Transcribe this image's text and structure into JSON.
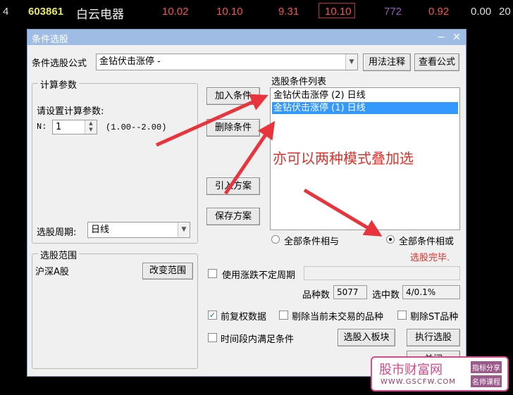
{
  "ticker": {
    "row_num": "4",
    "code": "603861",
    "name": "白云电器",
    "v1": "10.02",
    "v2": "10.10",
    "v3": "9.31",
    "v4": "10.10",
    "v5": "772",
    "v6": "0.92",
    "v7": "0.00",
    "v8": "20"
  },
  "dialog": {
    "title": "条件选股",
    "minimize_glyph": "−",
    "close_glyph": "✕",
    "formula_label": "条件选股公式",
    "formula_value": "金钻伏击涨停 -",
    "btn_usage": "用法注释",
    "btn_view": "查看公式",
    "calc_group_title": "计算参数",
    "calc_prompt": "请设置计算参数:",
    "n_label": "N:",
    "n_value": "1",
    "n_range": "(1.00--2.00)",
    "period_label": "选股周期:",
    "period_value": "日线",
    "range_group_title": "选股范围",
    "range_value": "沪深A股",
    "btn_change_range": "改变范围",
    "btn_add": "加入条件",
    "btn_delete": "删除条件",
    "btn_import": "引入方案",
    "btn_save": "保存方案",
    "list_title": "选股条件列表",
    "list_items": [
      "金钻伏击涨停 (2) 日线",
      "金钻伏击涨停 (1) 日线"
    ],
    "annotation": "亦可以两种模式叠加选",
    "radio_and": "全部条件相与",
    "radio_or": "全部条件相或",
    "status": "选股完毕.",
    "chk_uncertain": "使用涨跌不定周期",
    "count_label": "品种数",
    "count_value": "5077",
    "selected_label": "选中数",
    "selected_value": "4/0.1%",
    "chk_adjust": "前复权数据",
    "chk_exclude_untraded": "剔除当前未交易的品种",
    "chk_exclude_st": "剔除ST品种",
    "chk_timeperiod": "时间段内满足条件",
    "btn_to_board": "选股入板块",
    "btn_execute": "执行选股",
    "btn_close": "关闭"
  },
  "watermark": {
    "brand": "股市财富网",
    "url": "WWW.GSCFW.COM",
    "tag1": "指标分享",
    "tag2": "名师课程"
  },
  "colors": {
    "title_bar": "#9fbde4",
    "selection": "#3399ff",
    "arrow": "#e8343c",
    "status": "#e0302a"
  }
}
